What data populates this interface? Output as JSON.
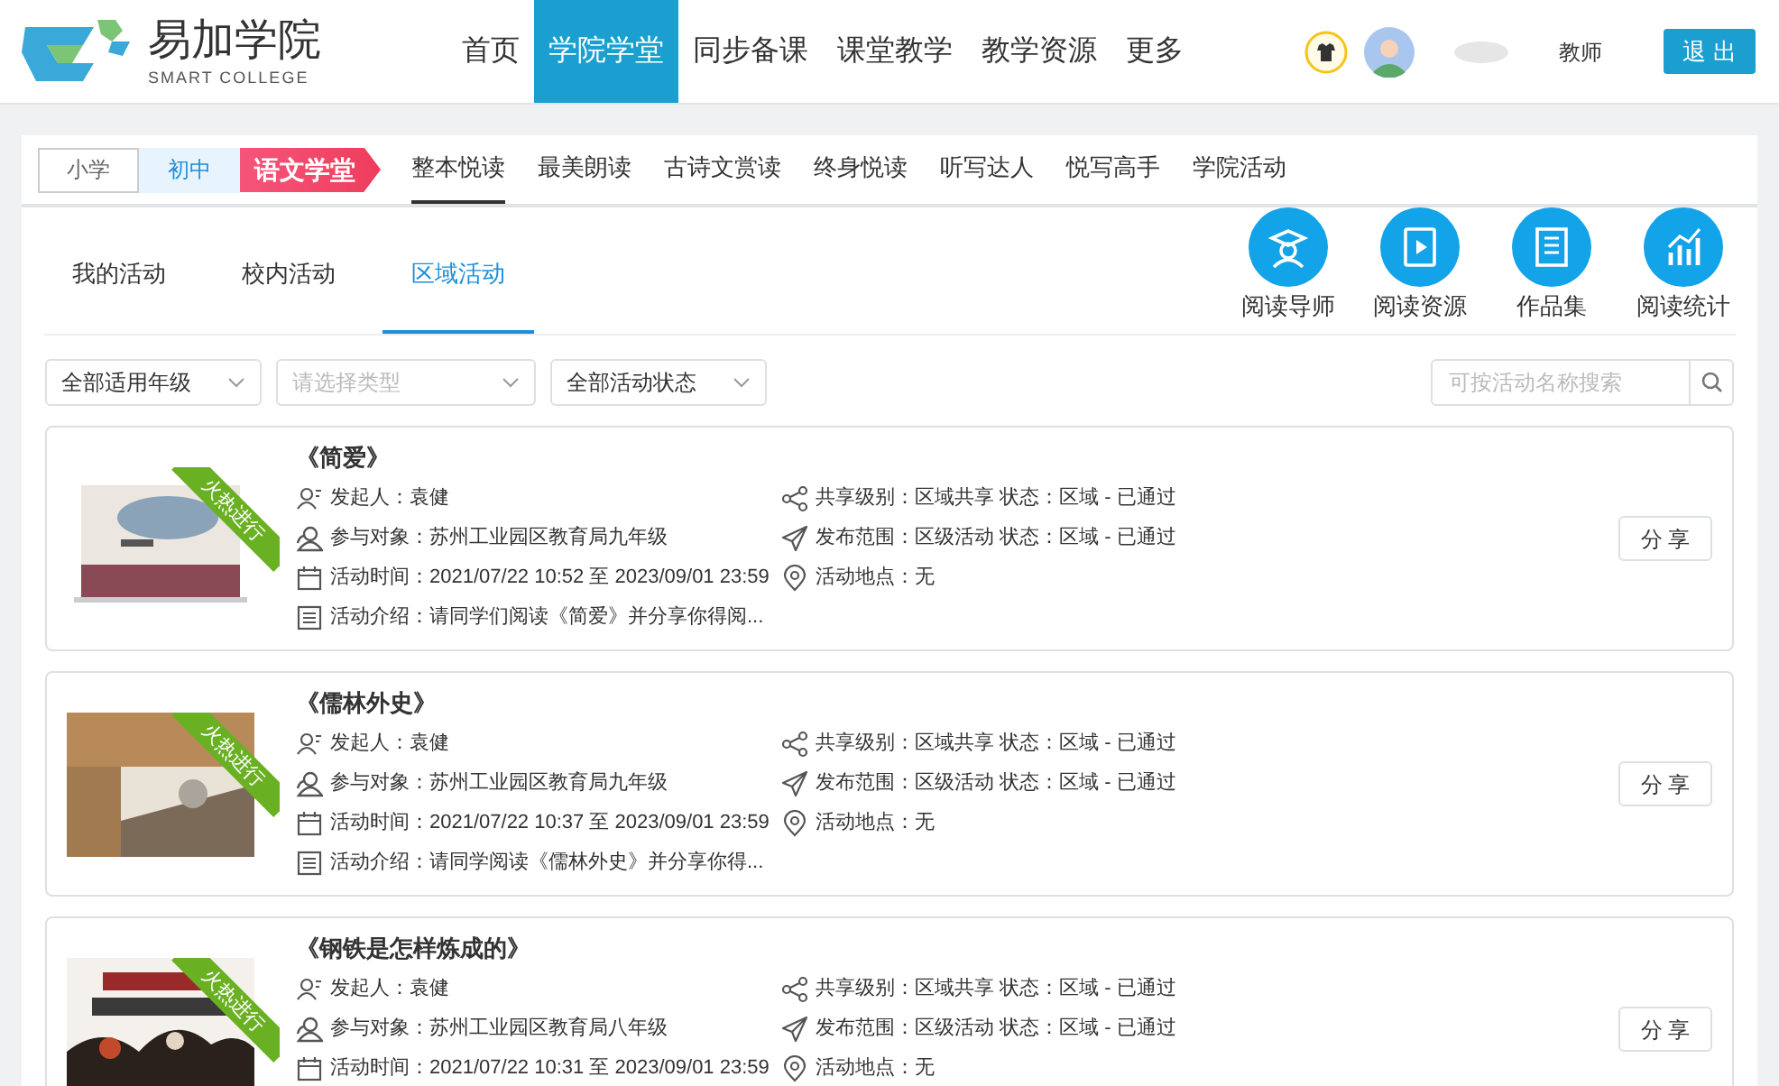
{
  "header": {
    "logo": {
      "name": "易加学院",
      "tagline": "SMART COLLEGE"
    },
    "nav": [
      {
        "label": "首页",
        "selected": false
      },
      {
        "label": "学院学堂",
        "selected": true
      },
      {
        "label": "同步备课",
        "selected": false
      },
      {
        "label": "课堂教学",
        "selected": false
      },
      {
        "label": "教学资源",
        "selected": false
      },
      {
        "label": "更多",
        "selected": false
      }
    ],
    "user": {
      "role": "教师"
    },
    "logout": "退 出"
  },
  "subnav": {
    "levels": [
      {
        "label": "小学",
        "selected": false
      },
      {
        "label": "初中",
        "selected": true
      }
    ],
    "badge": "语文学堂",
    "tabs": [
      {
        "label": "整本悦读",
        "selected": true
      },
      {
        "label": "最美朗读",
        "selected": false
      },
      {
        "label": "古诗文赏读",
        "selected": false
      },
      {
        "label": "终身悦读",
        "selected": false
      },
      {
        "label": "听写达人",
        "selected": false
      },
      {
        "label": "悦写高手",
        "selected": false
      },
      {
        "label": "学院活动",
        "selected": false
      }
    ]
  },
  "activity_tabs": [
    {
      "label": "我的活动",
      "selected": false
    },
    {
      "label": "校内活动",
      "selected": false
    },
    {
      "label": "区域活动",
      "selected": true
    }
  ],
  "shortcuts": [
    {
      "kind": "mentor",
      "label": "阅读导师"
    },
    {
      "kind": "resources",
      "label": "阅读资源"
    },
    {
      "kind": "works",
      "label": "作品集"
    },
    {
      "kind": "stats",
      "label": "阅读统计"
    }
  ],
  "filters": [
    {
      "value": "全部适用年级"
    },
    {
      "placeholder": "请选择类型"
    },
    {
      "value": "全部活动状态"
    }
  ],
  "search": {
    "placeholder": "可按活动名称搜索"
  },
  "cards": [
    {
      "title": "《简爱》",
      "ribbon": "火热进行",
      "left": [
        {
          "kind": "person",
          "text": "发起人：袁健"
        },
        {
          "kind": "group",
          "text": "参与对象：苏州工业园区教育局九年级"
        },
        {
          "kind": "calendar",
          "text": "活动时间：2021/07/22 10:52 至 2023/09/01 23:59"
        },
        {
          "kind": "intro",
          "text": "活动介绍：请同学们阅读《简爱》并分享你得阅..."
        }
      ],
      "right": [
        {
          "kind": "share",
          "text": "共享级别：区域共享 状态：区域 - 已通过"
        },
        {
          "kind": "send",
          "text": "发布范围：区级活动 状态：区域 - 已通过"
        },
        {
          "kind": "location",
          "text": "活动地点：无"
        }
      ],
      "button": "分 享"
    },
    {
      "title": "《儒林外史》",
      "ribbon": "火热进行",
      "left": [
        {
          "kind": "person",
          "text": "发起人：袁健"
        },
        {
          "kind": "group",
          "text": "参与对象：苏州工业园区教育局九年级"
        },
        {
          "kind": "calendar",
          "text": "活动时间：2021/07/22 10:37 至 2023/09/01 23:59"
        },
        {
          "kind": "intro",
          "text": "活动介绍：请同学阅读《儒林外史》并分享你得..."
        }
      ],
      "right": [
        {
          "kind": "share",
          "text": "共享级别：区域共享 状态：区域 - 已通过"
        },
        {
          "kind": "send",
          "text": "发布范围：区级活动 状态：区域 - 已通过"
        },
        {
          "kind": "location",
          "text": "活动地点：无"
        }
      ],
      "button": "分 享"
    },
    {
      "title": "《钢铁是怎样炼成的》",
      "ribbon": "火热进行",
      "left": [
        {
          "kind": "person",
          "text": "发起人：袁健"
        },
        {
          "kind": "group",
          "text": "参与对象：苏州工业园区教育局八年级"
        },
        {
          "kind": "calendar",
          "text": "活动时间：2021/07/22 10:31 至 2023/09/01 23:59"
        }
      ],
      "right": [
        {
          "kind": "share",
          "text": "共享级别：区域共享 状态：区域 - 已通过"
        },
        {
          "kind": "send",
          "text": "发布范围：区级活动 状态：区域 - 已通过"
        },
        {
          "kind": "location",
          "text": "活动地点：无"
        }
      ],
      "button": "分 享"
    }
  ]
}
